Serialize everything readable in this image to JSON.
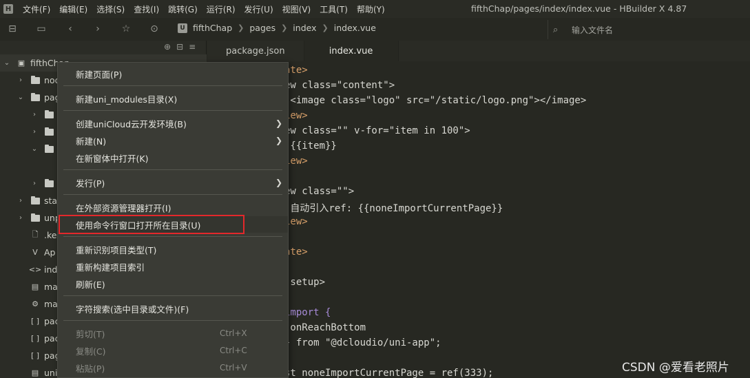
{
  "menubar": {
    "logo": "H",
    "items": [
      "文件(F)",
      "编辑(E)",
      "选择(S)",
      "查找(I)",
      "跳转(G)",
      "运行(R)",
      "发行(U)",
      "视图(V)",
      "工具(T)",
      "帮助(Y)"
    ],
    "title": "fifthChap/pages/index/index.vue - HBuilder X 4.87"
  },
  "toolbar": {
    "crumb_logo": "U",
    "crumbs": [
      "fifthChap",
      "pages",
      "index",
      "index.vue"
    ],
    "search_placeholder": "输入文件名"
  },
  "sidebar": {
    "root": "fifthChap",
    "rows": [
      {
        "text": "nod"
      },
      {
        "text": "pag"
      },
      {
        "text": ""
      },
      {
        "text": ""
      },
      {
        "text": ""
      },
      {
        "text": ""
      },
      {
        "text": "sta"
      },
      {
        "text": "unp"
      },
      {
        "text": ".ke"
      },
      {
        "text": "Ap"
      },
      {
        "text": "ind"
      },
      {
        "text": "ma"
      },
      {
        "text": "ma"
      },
      {
        "text": "pac"
      },
      {
        "text": "pac"
      },
      {
        "text": "pag"
      },
      {
        "text": "uni"
      }
    ]
  },
  "tabs": [
    "package.json",
    "index.vue"
  ],
  "context_menu": {
    "items": [
      {
        "label": "新建页面(P)"
      },
      {
        "label": "新建uni_modules目录(X)"
      },
      {
        "label": "创建uniCloud云开发环境(B)",
        "submenu": true
      },
      {
        "label": "新建(N)",
        "submenu": true
      },
      {
        "label": "在新窗体中打开(K)"
      },
      {
        "label": "发行(P)",
        "submenu": true
      },
      {
        "label": "在外部资源管理器打开(I)"
      },
      {
        "label": "使用命令行窗口打开所在目录(U)"
      },
      {
        "label": "重新识别项目类型(T)"
      },
      {
        "label": "重新构建项目索引"
      },
      {
        "label": "刷新(E)"
      },
      {
        "label": "字符搜索(选中目录或文件)(F)"
      },
      {
        "label": "剪切(T)",
        "shortcut": "Ctrl+X",
        "disabled": true
      },
      {
        "label": "复制(C)",
        "shortcut": "Ctrl+C",
        "disabled": true
      },
      {
        "label": "粘贴(P)",
        "shortcut": "Ctrl+V",
        "disabled": true
      }
    ]
  },
  "code": [
    "ate>",
    "ew class=\"content\">",
    " <image class=\"logo\" src=\"/static/logo.png\"></image>",
    "iew>",
    "ew class=\"\" v-for=\"item in 100\">",
    " {{item}}",
    "iew>",
    "",
    "ew class=\"\">",
    " 自动引入ref: {{noneImportCurrentPage}}",
    "iew>",
    "",
    "ate>",
    "",
    " setup>",
    "",
    "import {",
    " onReachBottom",
    "} from \"@dcloudio/uni-app\";",
    "",
    "st noneImportCurrentPage = ref(333);"
  ],
  "watermark": "CSDN @爱看老照片"
}
